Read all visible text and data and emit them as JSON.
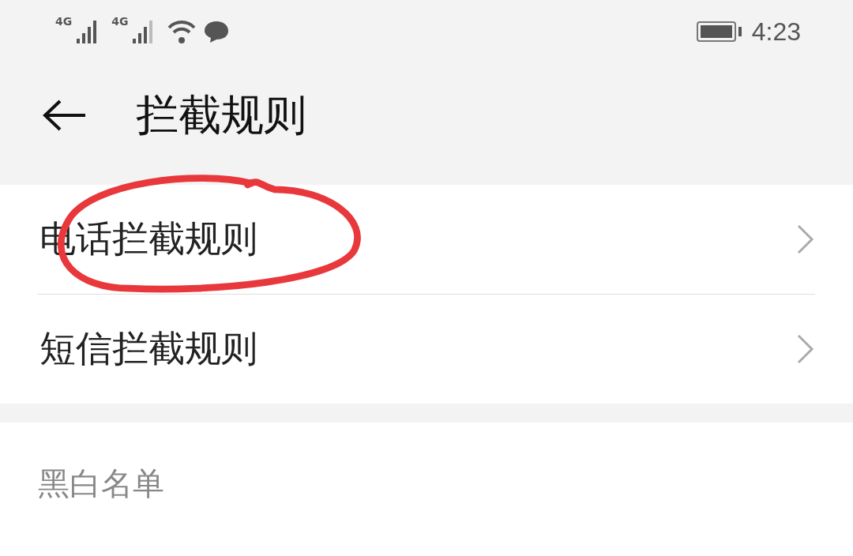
{
  "status_bar": {
    "network_labels": [
      "4G",
      "4G"
    ],
    "time": "4:23"
  },
  "header": {
    "title": "拦截规则"
  },
  "rules": [
    {
      "label": "电话拦截规则",
      "circled": true
    },
    {
      "label": "短信拦截规则",
      "circled": false
    }
  ],
  "section": {
    "title": "黑白名单"
  }
}
